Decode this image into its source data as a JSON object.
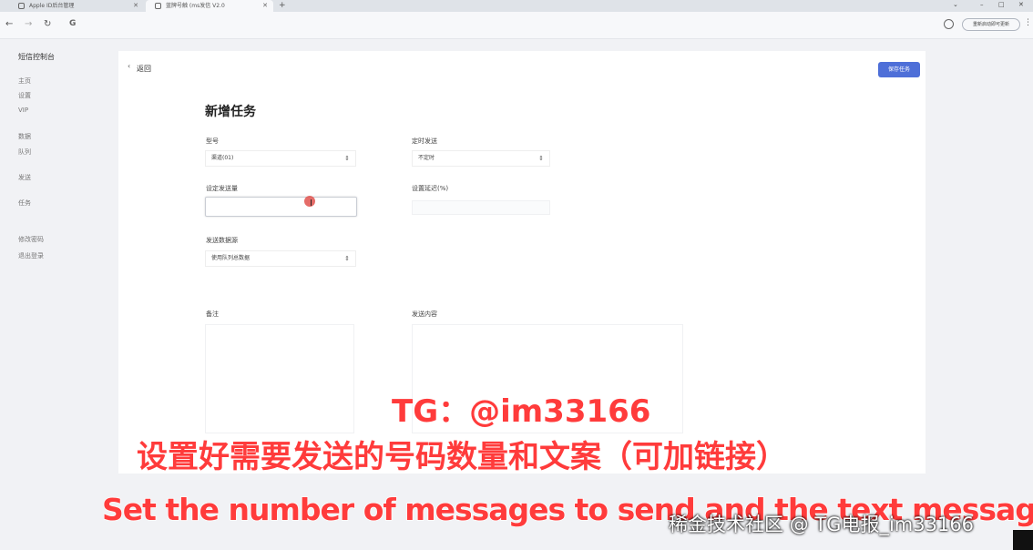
{
  "browser": {
    "tabs": [
      {
        "label": "Apple ID后台管理"
      },
      {
        "label": "蓝牌号触 (ms发信 V2.0"
      }
    ],
    "new_tab": "+",
    "window_controls": {
      "minimize": "–",
      "maximize": "□",
      "close": "✕"
    },
    "nav": {
      "back": "←",
      "forward": "→",
      "reload": "↻",
      "omnibox_icon": "G"
    },
    "update_button": "重新启动即可更新",
    "menu": "⋮"
  },
  "sidebar": {
    "title": "短信控制台",
    "items": [
      {
        "label": "主页"
      },
      {
        "label": "设置"
      },
      {
        "label": "VIP"
      },
      {
        "label": "数据"
      },
      {
        "label": "队列"
      },
      {
        "label": "发送"
      },
      {
        "label": "任务"
      },
      {
        "label": "修改密码"
      },
      {
        "label": "退出登录"
      }
    ]
  },
  "header": {
    "back_icon": "‹",
    "back_label": "返回",
    "create_button": "保存任务"
  },
  "form": {
    "title": "新增任务",
    "account": {
      "label": "型号",
      "value": "渠道(01)"
    },
    "schedule": {
      "label": "定时发送",
      "value": "不定时"
    },
    "send_count": {
      "label": "设定发送量",
      "value": ""
    },
    "interval": {
      "label": "设置延迟(%)",
      "value": ""
    },
    "data_source": {
      "label": "发送数据源",
      "value": "使用队列总数据"
    },
    "remark": {
      "label": "备注",
      "value": ""
    },
    "content": {
      "label": "发送内容",
      "value": ""
    }
  },
  "overlay": {
    "tg_caption": "TG：@im33166",
    "cn_caption": "设置好需要发送的号码数量和文案（可加链接）",
    "en_caption": "Set the number of messages to send and the text message",
    "watermark": "稀金技术社区 @ TG电报_im33166"
  }
}
